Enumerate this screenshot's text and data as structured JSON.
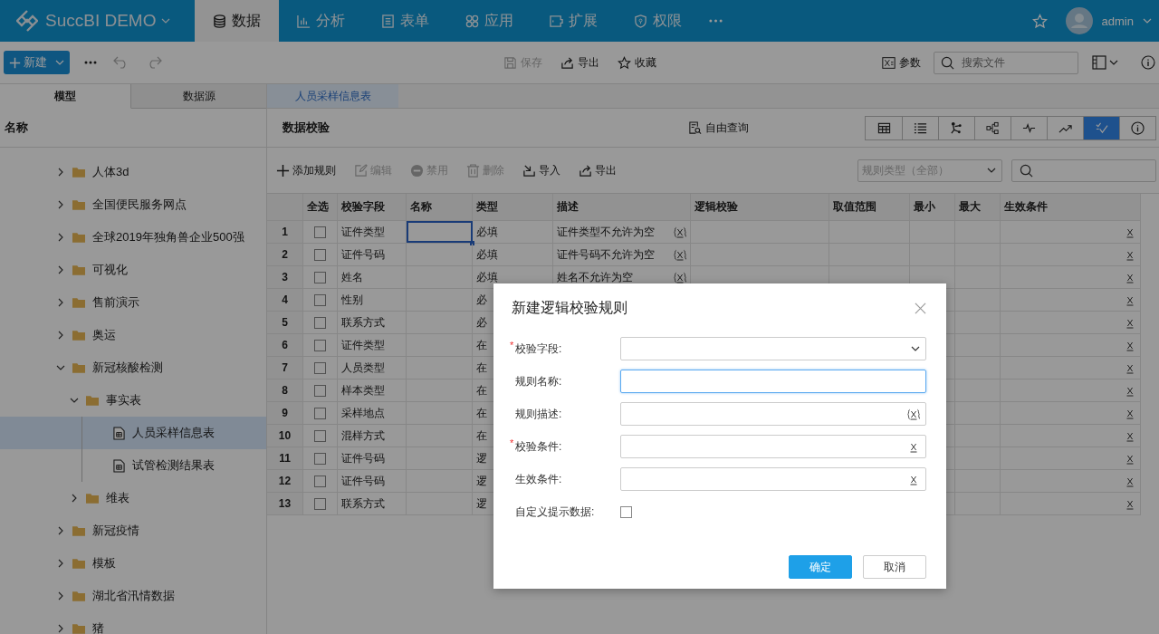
{
  "topbar": {
    "product": "SuccBI DEMO",
    "user": "admin",
    "nav": [
      {
        "label": "数据",
        "kind": "database",
        "selected": true
      },
      {
        "label": "分析",
        "kind": "chart",
        "selected": false
      },
      {
        "label": "表单",
        "kind": "form",
        "selected": false
      },
      {
        "label": "应用",
        "kind": "apps",
        "selected": false
      },
      {
        "label": "扩展",
        "kind": "extend",
        "selected": false
      },
      {
        "label": "权限",
        "kind": "shield",
        "selected": false
      }
    ]
  },
  "toolbar": {
    "new_button": "新建",
    "actions": [
      {
        "label": "保存",
        "kind": "save",
        "disabled": true
      },
      {
        "label": "导出",
        "kind": "export",
        "disabled": false
      },
      {
        "label": "收藏",
        "kind": "star",
        "disabled": false
      }
    ],
    "params_button": "参数",
    "search": {
      "placeholder": "搜索文件"
    }
  },
  "left_tabs": [
    {
      "label": "模型",
      "selected": true
    },
    {
      "label": "数据源",
      "selected": false
    }
  ],
  "doc_tabs": [
    {
      "label": "人员采样信息表",
      "selected": true
    }
  ],
  "tree": {
    "header": "名称",
    "items": [
      {
        "label": "人体3d",
        "kind": "folder",
        "expanded": false
      },
      {
        "label": "全国便民服务网点",
        "kind": "folder",
        "expanded": false
      },
      {
        "label": "全球2019年独角兽企业500强",
        "kind": "folder",
        "expanded": false
      },
      {
        "label": "可视化",
        "kind": "folder",
        "expanded": false
      },
      {
        "label": "售前演示",
        "kind": "folder",
        "expanded": false
      },
      {
        "label": "奥运",
        "kind": "folder",
        "expanded": false
      },
      {
        "label": "新冠核酸检测",
        "kind": "folder",
        "expanded": true,
        "children": [
          {
            "label": "事实表",
            "kind": "folder",
            "expanded": true,
            "children": [
              {
                "label": "人员采样信息表",
                "kind": "table",
                "selected": true
              },
              {
                "label": "试管检测结果表",
                "kind": "table",
                "selected": false
              }
            ]
          },
          {
            "label": "维表",
            "kind": "folder",
            "expanded": false
          }
        ]
      },
      {
        "label": "新冠疫情",
        "kind": "folder",
        "expanded": false
      },
      {
        "label": "模板",
        "kind": "folder",
        "expanded": false
      },
      {
        "label": "湖北省汛情数据",
        "kind": "folder",
        "expanded": false
      },
      {
        "label": "猪",
        "kind": "folder",
        "expanded": false
      }
    ]
  },
  "panel": {
    "title": "数据校验",
    "free_query": "自由查询",
    "views": [
      {
        "kind": "grid",
        "selected": false
      },
      {
        "kind": "list",
        "selected": false
      },
      {
        "kind": "lineage",
        "selected": false
      },
      {
        "kind": "tree",
        "selected": false
      },
      {
        "kind": "pulse",
        "selected": false
      },
      {
        "kind": "trend",
        "selected": false
      },
      {
        "kind": "check",
        "selected": true
      },
      {
        "kind": "info",
        "selected": false
      }
    ]
  },
  "rule_toolbar": {
    "actions": [
      {
        "label": "添加规则",
        "kind": "add",
        "disabled": false
      },
      {
        "label": "编辑",
        "kind": "edit",
        "disabled": true
      },
      {
        "label": "禁用",
        "kind": "disable",
        "disabled": true
      },
      {
        "label": "删除",
        "kind": "delete",
        "disabled": true
      },
      {
        "label": "导入",
        "kind": "import",
        "disabled": false
      },
      {
        "label": "导出",
        "kind": "export",
        "disabled": false
      }
    ],
    "type_filter": {
      "value": "规则类型（全部）"
    }
  },
  "table": {
    "columns": [
      "全选",
      "校验字段",
      "名称",
      "类型",
      "描述",
      "逻辑校验",
      "取值范围",
      "最小",
      "最大",
      "生效条件"
    ],
    "rows": [
      {
        "num": "1",
        "checked": false,
        "field": "证件类型",
        "type": "必填",
        "desc": "证件类型不允许为空",
        "focused": true
      },
      {
        "num": "2",
        "checked": false,
        "field": "证件号码",
        "type": "必填",
        "desc": "证件号码不允许为空",
        "focused": false
      },
      {
        "num": "3",
        "checked": false,
        "field": "姓名",
        "type": "必填",
        "desc": "姓名不允许为空",
        "focused": false
      },
      {
        "num": "4",
        "checked": false,
        "field": "性别",
        "type": "必",
        "focused": false
      },
      {
        "num": "5",
        "checked": false,
        "field": "联系方式",
        "type": "必",
        "focused": false
      },
      {
        "num": "6",
        "checked": false,
        "field": "证件类型",
        "type": "在",
        "focused": false
      },
      {
        "num": "7",
        "checked": false,
        "field": "人员类型",
        "type": "在",
        "focused": false
      },
      {
        "num": "8",
        "checked": false,
        "field": "样本类型",
        "type": "在",
        "focused": false
      },
      {
        "num": "9",
        "checked": false,
        "field": "采样地点",
        "type": "在",
        "focused": false
      },
      {
        "num": "10",
        "checked": false,
        "field": "混样方式",
        "type": "在",
        "focused": false
      },
      {
        "num": "11",
        "checked": false,
        "field": "证件号码",
        "type": "逻",
        "focused": false
      },
      {
        "num": "12",
        "checked": false,
        "field": "证件号码",
        "type": "逻",
        "focused": false
      },
      {
        "num": "13",
        "checked": false,
        "field": "联系方式",
        "type": "逻",
        "focused": false
      }
    ]
  },
  "dialog": {
    "title": "新建逻辑校验规则",
    "fields": [
      {
        "label": "校验字段:",
        "marker": "*",
        "kind": "select",
        "focused": false
      },
      {
        "label": "规则名称:",
        "kind": "text",
        "focused": true
      },
      {
        "label": "规则描述:",
        "kind": "variable",
        "focused": false
      },
      {
        "label": "校验条件:",
        "marker": "*",
        "kind": "formula",
        "focused": false
      },
      {
        "label": "生效条件:",
        "kind": "formula",
        "focused": false
      }
    ],
    "option": {
      "label": "自定义提示数据:",
      "checked": false
    },
    "buttons": [
      {
        "label": "确定",
        "primary": true
      },
      {
        "label": "取消",
        "primary": false
      }
    ]
  }
}
